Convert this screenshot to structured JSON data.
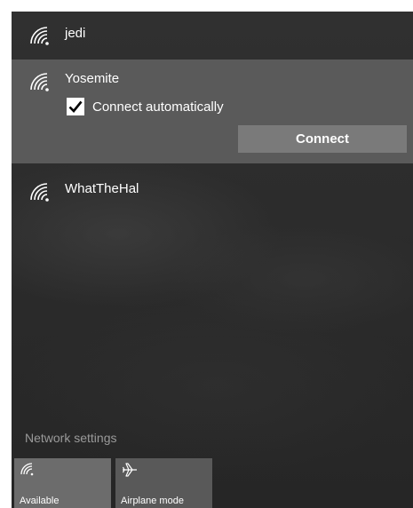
{
  "networks": [
    {
      "ssid": "jedi",
      "icon": "wifi-secured-icon"
    },
    {
      "ssid": "Yosemite",
      "icon": "wifi-secured-icon",
      "connect_automatically": {
        "label": "Connect automatically",
        "checked": true
      },
      "connect_button": "Connect"
    },
    {
      "ssid": "WhatTheHal",
      "icon": "wifi-secured-icon"
    }
  ],
  "footer": {
    "settings_link": "Network settings",
    "tiles": [
      {
        "label": "Available",
        "icon": "wifi-icon"
      },
      {
        "label": "Airplane mode",
        "icon": "airplane-icon"
      }
    ]
  },
  "colors": {
    "background": "#2b2b2b",
    "selected_row": "#5a5a5a",
    "button": "#7a7a7a",
    "settings_text": "#9a9a9a"
  }
}
